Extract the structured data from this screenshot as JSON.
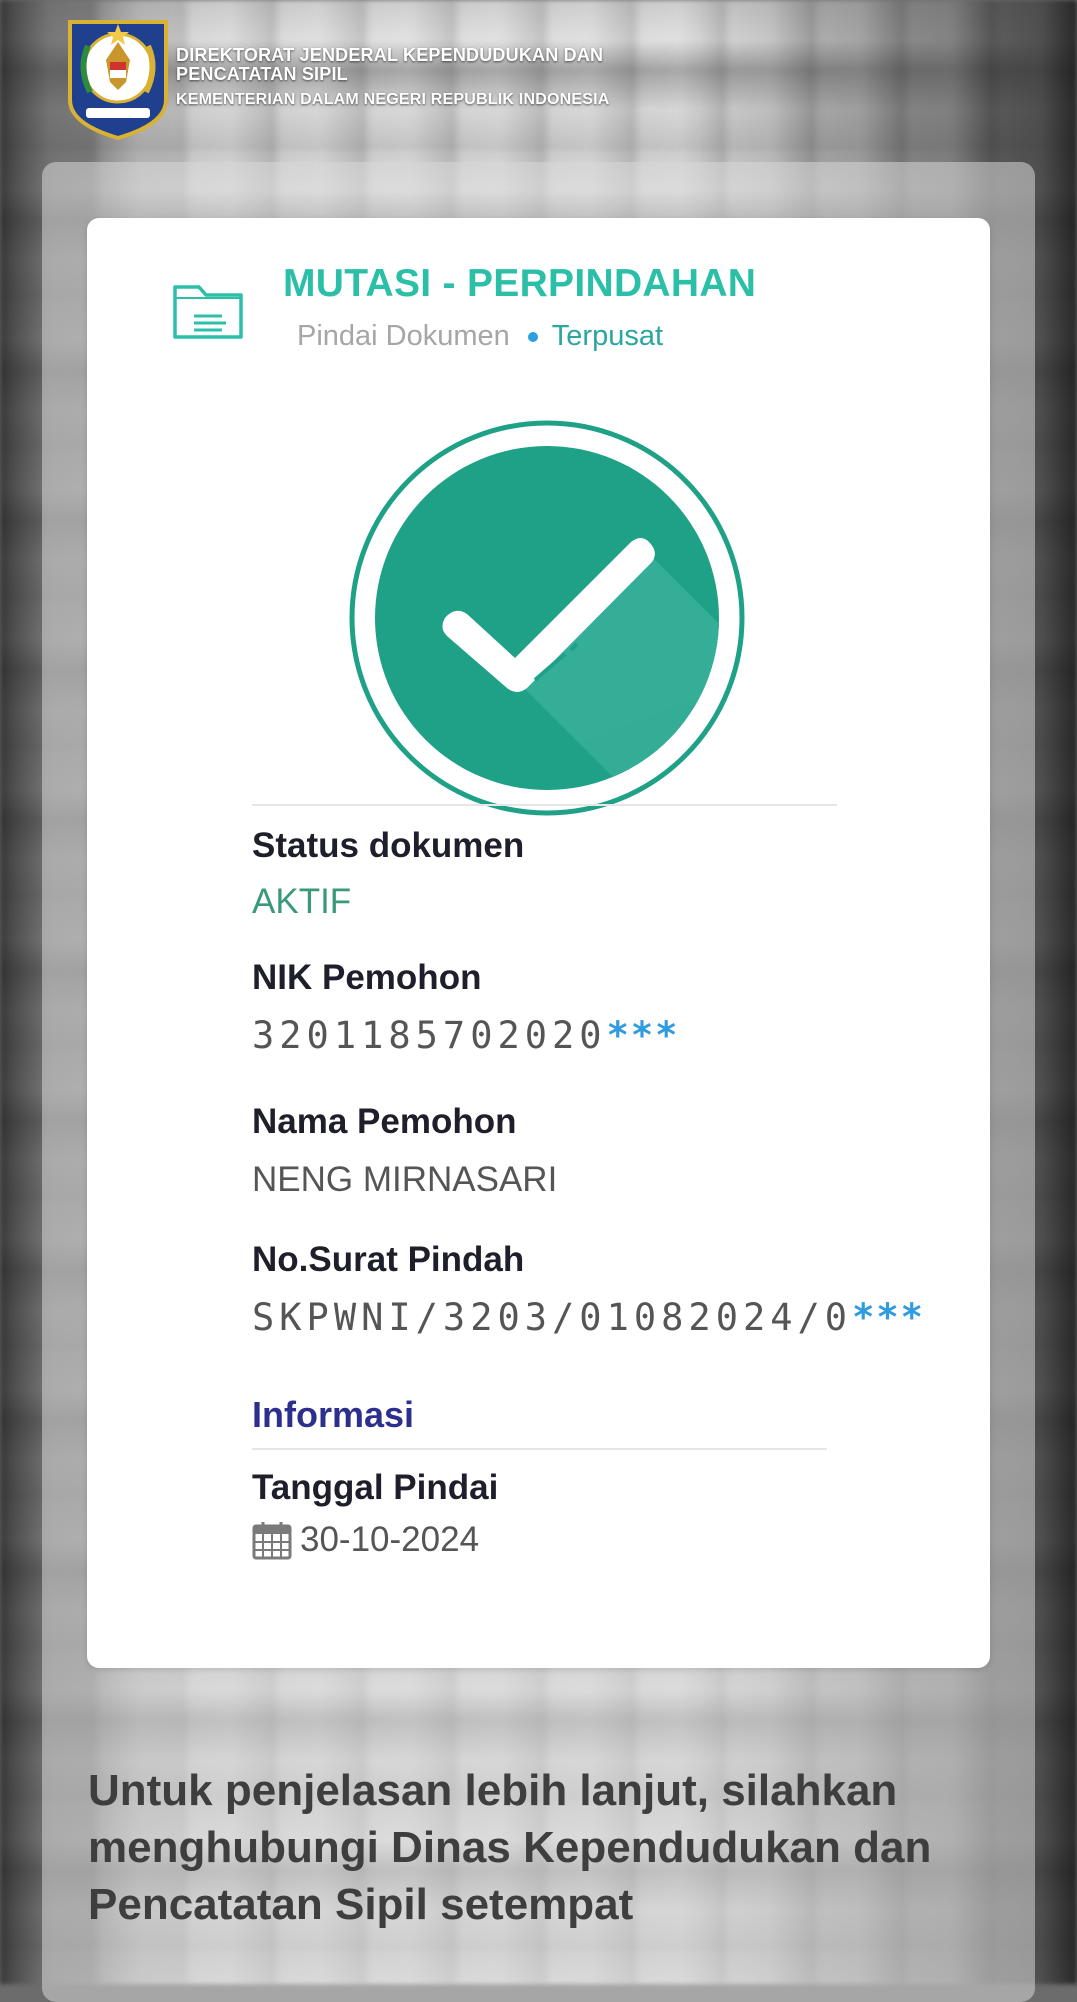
{
  "header": {
    "line1": "DIREKTORAT JENDERAL KEPENDUDUKAN DAN",
    "line2": "PENCATATAN SIPIL",
    "line3": "KEMENTERIAN DALAM NEGERI REPUBLIK INDONESIA",
    "emblem_icon": "dukcapil-emblem-icon"
  },
  "card": {
    "title": "MUTASI - PERPINDAHAN",
    "subtitle": "Pindai Dokumen",
    "subtitle_tag": "Terpusat",
    "icon": "folder-document-icon",
    "status_icon": "check-circle-icon",
    "accent_color": "#2bbfa8",
    "check_color": "#1fa187"
  },
  "fields": {
    "status": {
      "label": "Status dokumen",
      "value": "AKTIF"
    },
    "nik": {
      "label": "NIK Pemohon",
      "value": "3201185702020",
      "mask": "***"
    },
    "nama": {
      "label": "Nama Pemohon",
      "value": "NENG MIRNASARI"
    },
    "surat": {
      "label": "No.Surat Pindah",
      "value": "SKPWNI/3203/01082024/0",
      "mask": "***"
    }
  },
  "info": {
    "heading": "Informasi",
    "date_label": "Tanggal Pindai",
    "date_icon": "calendar-icon",
    "date_value": "30-10-2024"
  },
  "footer": {
    "note": "Untuk penjelasan lebih lanjut, silahkan menghubungi Dinas Kependudukan dan Pencatatan Sipil setempat"
  }
}
